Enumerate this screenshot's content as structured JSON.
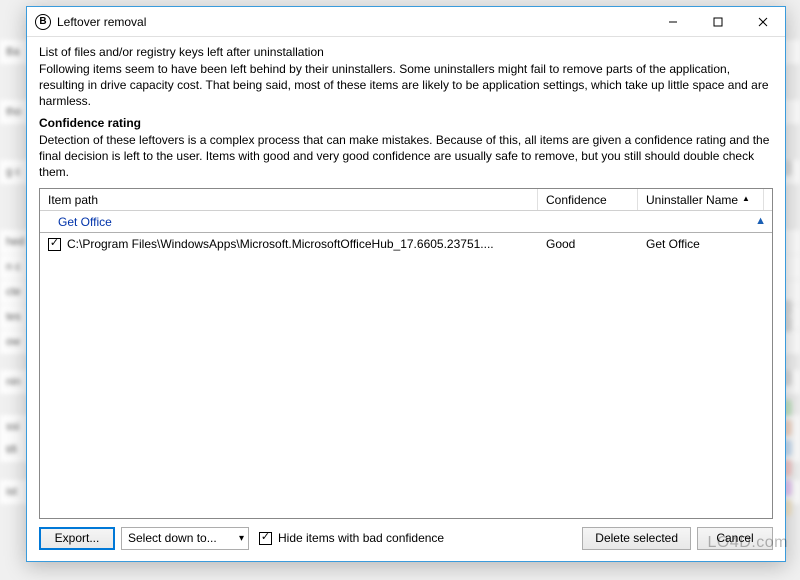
{
  "window": {
    "title": "Leftover removal",
    "icon_letter": "B"
  },
  "sections": {
    "list_title": "List of files and/or registry keys left after uninstallation",
    "list_desc": "Following items seem to have been left behind by their uninstallers. Some uninstallers might fail to remove parts of the application, resulting in drive capacity cost. That being said, most of these items are likely to be application settings, which take up little space and are harmless.",
    "conf_title": "Confidence rating",
    "conf_desc": "Detection of these leftovers is a complex process that can make mistakes. Because of this, all items are given a confidence rating and the final decision is left to the user. Items with good and very good confidence are usually safe to remove, but you still should double check them."
  },
  "columns": {
    "path": "Item path",
    "confidence": "Confidence",
    "uninstaller": "Uninstaller Name"
  },
  "group": {
    "name": "Get Office"
  },
  "items": [
    {
      "checked": true,
      "path": "C:\\Program Files\\WindowsApps\\Microsoft.MicrosoftOfficeHub_17.6605.23751....",
      "confidence": "Good",
      "uninstaller": "Get Office"
    }
  ],
  "footer": {
    "export": "Export...",
    "select_down": "Select down to...",
    "hide_bad": "Hide items with bad confidence",
    "hide_bad_checked": true,
    "delete": "Delete selected",
    "cancel": "Cancel"
  },
  "watermark": "LO4D.com"
}
